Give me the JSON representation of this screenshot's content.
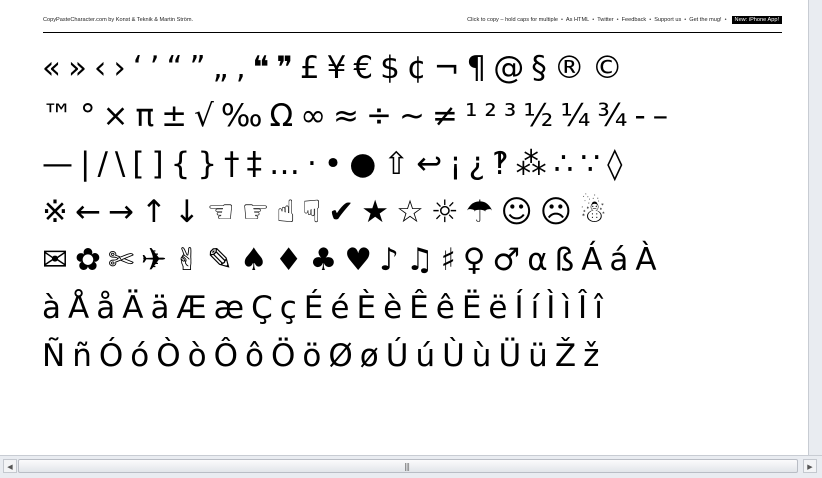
{
  "header": {
    "site_credit": "CopyPasteCharacter.com by Konst & Teknik & Martin Ström.",
    "links": [
      "Click to copy – hold caps for multiple",
      "As HTML",
      "Twitter",
      "Feedback",
      "Support us",
      "Get the mug!"
    ],
    "separator": "•",
    "iphone_app": "New: iPhone App!"
  },
  "characters": [
    [
      "«",
      "»",
      "‹",
      "›",
      "‘",
      "’",
      "“",
      "”",
      "„",
      "‚",
      "❝",
      "❞",
      "£",
      "¥",
      "€",
      "$",
      "¢",
      "¬",
      "¶",
      "@",
      "§",
      "®",
      "©"
    ],
    [
      "™",
      "°",
      "×",
      "π",
      "±",
      "√",
      "‰",
      "Ω",
      "∞",
      "≈",
      "÷",
      "~",
      "≠",
      "¹",
      "²",
      "³",
      "½",
      "¼",
      "¾",
      "-",
      "–"
    ],
    [
      "—",
      "|",
      "/",
      "\\",
      "[",
      "]",
      "{",
      "}",
      "†",
      "‡",
      "…",
      "·",
      "•",
      "●",
      "⇧",
      "↩",
      "¡",
      "¿",
      "‽",
      "⁂",
      "∴",
      "∵",
      "◊"
    ],
    [
      "※",
      "←",
      "→",
      "↑",
      "↓",
      "☜",
      "☞",
      "☝",
      "☟",
      "✔",
      "★",
      "☆",
      "☼",
      "☂",
      "☺",
      "☹",
      "☃"
    ],
    [
      "✉",
      "✿",
      "✄",
      "✈",
      "✌",
      "✎",
      "♠",
      "♦",
      "♣",
      "♥",
      "♪",
      "♫",
      "♯",
      "♀",
      "♂",
      "α",
      "ß",
      "Á",
      "á",
      "À"
    ],
    [
      "à",
      "Å",
      "å",
      "Ä",
      "ä",
      "Æ",
      "æ",
      "Ç",
      "ç",
      "É",
      "é",
      "È",
      "è",
      "Ê",
      "ê",
      "Ë",
      "ë",
      "Í",
      "í",
      "Ì",
      "ì",
      "Î",
      "î"
    ],
    [
      "Ñ",
      "ñ",
      "Ó",
      "ó",
      "Ò",
      "ò",
      "Ô",
      "ô",
      "Ö",
      "ö",
      "Ø",
      "ø",
      "Ú",
      "ú",
      "Ù",
      "ù",
      "Ü",
      "ü",
      "Ž",
      "ž"
    ]
  ],
  "scrollbar": {
    "left_arrow": "◀",
    "right_arrow": "▶",
    "grip": "|||"
  }
}
